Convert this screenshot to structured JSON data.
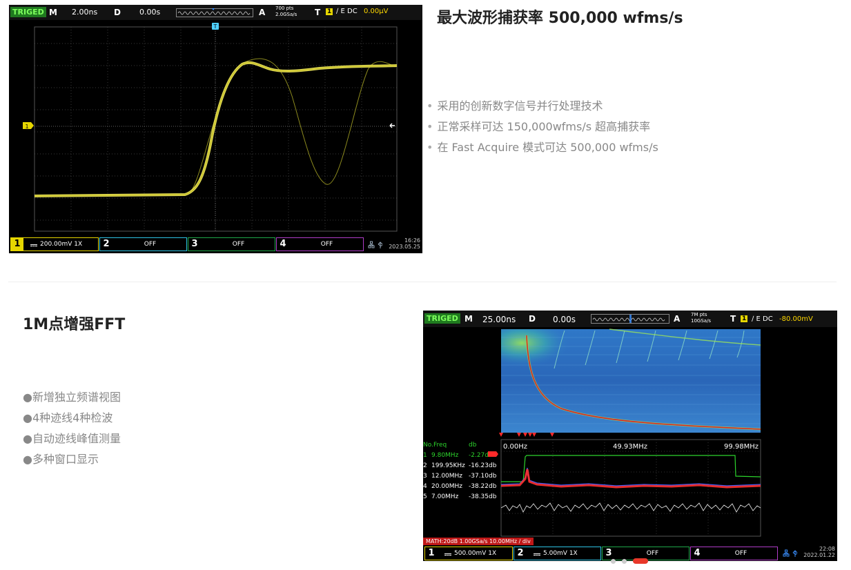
{
  "feature1": {
    "title": "最大波形捕获率 500,000 wfms/s",
    "bullets": [
      "采用的创新数字信号并行处理技术",
      "正常采样可达 150,000wfms/s 超高捕获率",
      "在 Fast Acquire 模式可达 500,000 wfms/s"
    ]
  },
  "feature2": {
    "title": "1M点增强FFT",
    "bullets": [
      "●新增独立频谱视图",
      "●4种迹线4种检波",
      "●自动迹线峰值测量",
      "●多种窗口显示"
    ]
  },
  "scope1": {
    "top": {
      "trig": "TRIGED",
      "m": "M",
      "time": "2.00ns",
      "d": "D",
      "delay": "0.00s",
      "a": "A",
      "pts": "700 pts",
      "rate": "2.0GSa/s",
      "t": "T",
      "src": "1",
      "slope": "∕ E DC",
      "level": "0.00μV"
    },
    "trigger_marker": "T",
    "ch_marker": "1",
    "channels": [
      {
        "num": "1",
        "text": "200.00mV 1X"
      },
      {
        "num": "2",
        "text": "OFF"
      },
      {
        "num": "3",
        "text": "OFF"
      },
      {
        "num": "4",
        "text": "OFF"
      }
    ],
    "time": "16:26",
    "date": "2023.05.25"
  },
  "scope2": {
    "top": {
      "trig": "TRIGED",
      "m": "M",
      "time": "25.00ns",
      "d": "D",
      "delay": "0.00s",
      "a": "A",
      "pts": "7M pts",
      "rate": "10GSa/s",
      "t": "T",
      "src": "1",
      "slope": "∕ E DC",
      "level": "-80.00mV"
    },
    "peaks_header": {
      "no": "No.Freq",
      "db": "db"
    },
    "peaks": [
      {
        "no": "1",
        "freq": "9.80MHz",
        "db": "-2.27db"
      },
      {
        "no": "2",
        "freq": "199.95KHz",
        "db": "-16.23db"
      },
      {
        "no": "3",
        "freq": "12.00MHz",
        "db": "-37.10db"
      },
      {
        "no": "4",
        "freq": "20.00MHz",
        "db": "-38.22db"
      },
      {
        "no": "5",
        "freq": "7.00MHz",
        "db": "-38.35db"
      }
    ],
    "freq_axis": [
      "0.00Hz",
      "49.93MHz",
      "99.98MHz"
    ],
    "math": "MATH:20dB  1.00GSa/s  10.00MHz / div",
    "channels": [
      {
        "num": "1",
        "text": "500.00mV  1X"
      },
      {
        "num": "2",
        "text": "5.00mV  1X"
      },
      {
        "num": "3",
        "text": "OFF"
      },
      {
        "num": "4",
        "text": "OFF"
      }
    ],
    "time": "22:08",
    "date": "2022.01.22"
  },
  "colors": {
    "ch1": "#e6d600",
    "ch2": "#2ec4e6",
    "ch3": "#1fa84a",
    "ch4": "#b03cc8",
    "accent": "#e8382a"
  },
  "carousel": {
    "slides": 3,
    "active": 3
  }
}
